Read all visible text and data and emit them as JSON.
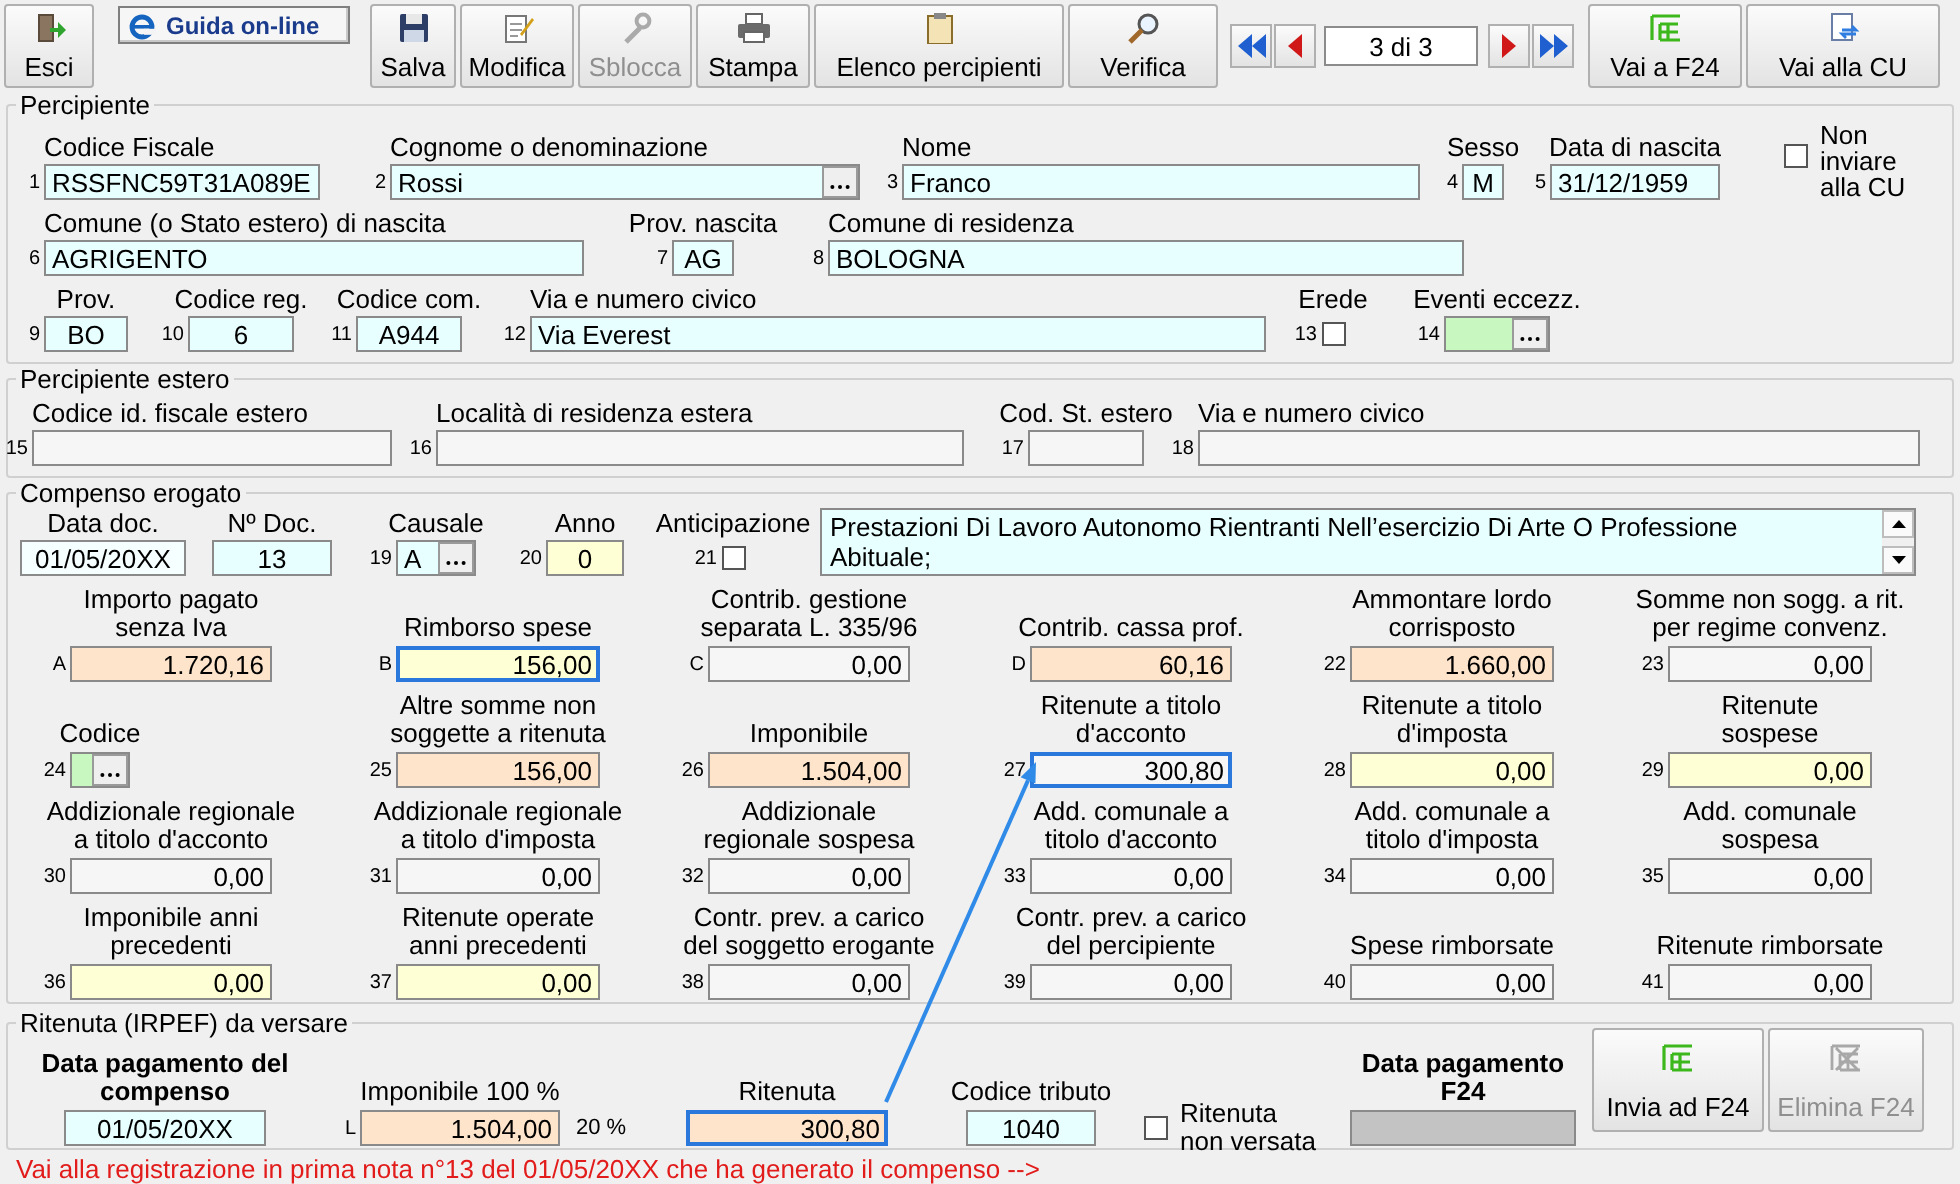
{
  "toolbar": {
    "exit_button": {
      "label": "Esci",
      "disabled": false
    },
    "help_link": "Guida on-line",
    "buttons": [
      {
        "label": "Salva",
        "disabled": false
      },
      {
        "label": "Modifica",
        "disabled": false
      },
      {
        "label": "Sblocca",
        "disabled": true
      },
      {
        "label": "Stampa",
        "disabled": false
      },
      {
        "label": "Elenco percipienti",
        "disabled": false
      },
      {
        "label": "Verifica",
        "disabled": false
      }
    ],
    "navigator": {
      "position": "3 di 3"
    },
    "right_buttons": [
      {
        "label": "Vai a F24",
        "disabled": false
      },
      {
        "label": "Vai alla CU",
        "disabled": false
      }
    ]
  },
  "percipiente": {
    "title": "Percipiente",
    "lines": [
      {
        "fields": [
          {
            "num": "1",
            "label": "Codice Fiscale",
            "value": "RSSFNC59T31A089E",
            "kind": "text",
            "color": "#e8ffff"
          },
          {
            "num": "2",
            "label": "Cognome o denominazione",
            "value": "Rossi",
            "kind": "lookup",
            "color": "#e8ffff"
          },
          {
            "num": "3",
            "label": "Nome",
            "value": "Franco",
            "kind": "text",
            "color": "#e8ffff"
          },
          {
            "num": "4",
            "label": "Sesso",
            "value": "M",
            "kind": "center",
            "color": "#e8ffff"
          },
          {
            "num": "5",
            "label": "Data di nascita",
            "value": "31/12/1959",
            "kind": "text",
            "color": "#e8ffff"
          }
        ]
      },
      {
        "fields": [
          {
            "num": "6",
            "label": "Comune (o Stato estero) di nascita",
            "value": "AGRIGENTO",
            "kind": "text",
            "color": "#e8ffff"
          },
          {
            "num": "7",
            "label": "Prov. nascita",
            "value": "AG",
            "kind": "center",
            "color": "#e8ffff"
          },
          {
            "num": "8",
            "label": "Comune di residenza",
            "value": "BOLOGNA",
            "kind": "text",
            "color": "#e8ffff"
          }
        ]
      },
      {
        "fields": [
          {
            "num": "9",
            "label": "Prov.",
            "value": "BO",
            "kind": "center",
            "color": "#e8ffff"
          },
          {
            "num": "10",
            "label": "Codice reg.",
            "value": "6",
            "kind": "center",
            "color": "#e8ffff"
          },
          {
            "num": "11",
            "label": "Codice com.",
            "value": "A944",
            "kind": "center",
            "color": "#e8ffff"
          },
          {
            "num": "12",
            "label": "Via e numero civico",
            "value": "Via Everest",
            "kind": "text",
            "color": "#e8ffff"
          },
          {
            "num": "13",
            "label": "Erede",
            "kind": "check",
            "checked": false
          },
          {
            "num": "14",
            "label": "Eventi eccezz.",
            "kind": "lookup",
            "color": "#c8f7c0"
          }
        ]
      }
    ],
    "non_inviare_cu": {
      "label": "Non inviare alla CU",
      "checked": false
    }
  },
  "percipiente_estero": {
    "title": "Percipiente estero",
    "lines": [
      {
        "fields": [
          {
            "num": "15",
            "label": "Codice id. fiscale estero",
            "color": "#f6f6f6"
          },
          {
            "num": "16",
            "label": "Località di residenza estera",
            "color": "#f6f6f6"
          },
          {
            "num": "17",
            "label": "Cod. St. estero",
            "color": "#f6f6f6"
          },
          {
            "num": "18",
            "label": "Via e numero civico",
            "color": "#f6f6f6"
          }
        ]
      }
    ]
  },
  "compenso": {
    "title": "Compenso erogato",
    "lines": [
      {
        "fields": [
          {
            "label": "Data doc.",
            "value": "01/05/20XX",
            "kind": "center",
            "color": "#f6ffff"
          },
          {
            "label": "Nº Doc.",
            "value": "13",
            "kind": "center",
            "color": "#e8ffff"
          },
          {
            "num": "19",
            "label": "Causale",
            "value": "A",
            "kind": "lookup",
            "color": "#e8ffff"
          },
          {
            "num": "20",
            "label": "Anno",
            "value": "0",
            "kind": "center",
            "color": "#ffffd5"
          },
          {
            "num": "21",
            "label": "Anticipazione",
            "kind": "check",
            "checked": false
          }
        ]
      },
      {
        "fields": [
          {
            "num": "A",
            "label": "Importo pagato\nsenza Iva",
            "value": "1.720,16",
            "kind": "amount",
            "color": "#fde4cb",
            "outlined": false
          },
          {
            "num": "B",
            "label": "Rimborso spese",
            "value": "156,00",
            "kind": "amount",
            "color": "#ffffd5",
            "outlined": true
          },
          {
            "num": "C",
            "label": "Contrib. gestione\nseparata L. 335/96",
            "value": "0,00",
            "kind": "amount",
            "color": "#f6f6f6",
            "outlined": false
          },
          {
            "num": "D",
            "label": "Contrib. cassa prof.",
            "value": "60,16",
            "kind": "amount",
            "color": "#fde4cb",
            "outlined": false
          },
          {
            "num": "22",
            "label": "Ammontare lordo\ncorrisposto",
            "value": "1.660,00",
            "kind": "amount",
            "color": "#fde4cb",
            "outlined": false
          },
          {
            "num": "23",
            "label": "Somme non sogg. a rit.\nper regime convenz.",
            "value": "0,00",
            "kind": "amount",
            "color": "#f6f6f6",
            "outlined": false
          }
        ]
      },
      {
        "fields": [
          {
            "num": "24",
            "label": "Codice",
            "kind": "lookup",
            "color": "#c8f7c0",
            "outlined": false
          },
          {
            "num": "25",
            "label": "Altre somme non\nsoggette a ritenuta",
            "value": "156,00",
            "kind": "amount",
            "color": "#fde4cb",
            "outlined": false
          },
          {
            "num": "26",
            "label": "Imponibile",
            "value": "1.504,00",
            "kind": "amount",
            "color": "#fde4cb",
            "outlined": false
          },
          {
            "num": "27",
            "label": "Ritenute a titolo\nd'acconto",
            "value": "300,80",
            "kind": "amount",
            "color": "#f6f6f6",
            "outlined": true
          },
          {
            "num": "28",
            "label": "Ritenute a titolo\nd'imposta",
            "value": "0,00",
            "kind": "amount",
            "color": "#ffffd5",
            "outlined": false
          },
          {
            "num": "29",
            "label": "Ritenute\nsospese",
            "value": "0,00",
            "kind": "amount",
            "color": "#ffffd5",
            "outlined": false
          }
        ]
      },
      {
        "fields": [
          {
            "num": "30",
            "label": "Addizionale regionale\na titolo d'acconto",
            "value": "0,00",
            "kind": "amount",
            "color": "#f6f6f6",
            "outlined": false
          },
          {
            "num": "31",
            "label": "Addizionale regionale\na titolo d'imposta",
            "value": "0,00",
            "kind": "amount",
            "color": "#f6f6f6",
            "outlined": false
          },
          {
            "num": "32",
            "label": "Addizionale\nregionale sospesa",
            "value": "0,00",
            "kind": "amount",
            "color": "#f6f6f6",
            "outlined": false
          },
          {
            "num": "33",
            "label": "Add. comunale a\ntitolo d'acconto",
            "value": "0,00",
            "kind": "amount",
            "color": "#f6f6f6",
            "outlined": false
          },
          {
            "num": "34",
            "label": "Add. comunale a\ntitolo d'imposta",
            "value": "0,00",
            "kind": "amount",
            "color": "#f6f6f6",
            "outlined": false
          },
          {
            "num": "35",
            "label": "Add. comunale\nsospesa",
            "value": "0,00",
            "kind": "amount",
            "color": "#f6f6f6",
            "outlined": false
          }
        ]
      },
      {
        "fields": [
          {
            "num": "36",
            "label": "Imponibile anni\nprecedenti",
            "value": "0,00",
            "kind": "amount",
            "color": "#ffffd5",
            "outlined": false
          },
          {
            "num": "37",
            "label": "Ritenute operate\nanni precedenti",
            "value": "0,00",
            "kind": "amount",
            "color": "#ffffd5",
            "outlined": false
          },
          {
            "num": "38",
            "label": "Contr. prev. a carico\ndel soggetto erogante",
            "value": "0,00",
            "kind": "amount",
            "color": "#f6f6f6",
            "outlined": false
          },
          {
            "num": "39",
            "label": "Contr. prev. a carico\ndel percipiente",
            "value": "0,00",
            "kind": "amount",
            "color": "#f6f6f6",
            "outlined": false
          },
          {
            "num": "40",
            "label": "Spese rimborsate",
            "value": "0,00",
            "kind": "amount",
            "color": "#f6f6f6",
            "outlined": false
          },
          {
            "num": "41",
            "label": "Ritenute rimborsate",
            "value": "0,00",
            "kind": "amount",
            "color": "#f6f6f6",
            "outlined": false
          }
        ]
      }
    ],
    "description": "Prestazioni Di Lavoro Autonomo Rientranti Nell’esercizio Di Arte O Professione Abituale;"
  },
  "ritenuta": {
    "title": "Ritenuta (IRPEF) da versare",
    "lines": [
      {
        "fields": [
          {
            "label": "Data pagamento del\ncompenso",
            "value": "01/05/20XX",
            "kind": "center",
            "color": "#e8ffff",
            "bold": true,
            "outlined": false
          },
          {
            "num": "L",
            "label": "Imponibile 100 %",
            "value": "1.504,00",
            "suffix": "20 %",
            "kind": "amount",
            "color": "#fde4cb",
            "bold": false,
            "outlined": false
          },
          {
            "label": "Ritenuta",
            "value": "300,80",
            "kind": "amount",
            "color": "#fde4cb",
            "bold": false,
            "outlined": true
          },
          {
            "label": "Codice tributo",
            "value": "1040",
            "kind": "center",
            "color": "#e8ffff",
            "bold": false,
            "outlined": false
          },
          {
            "label": "Ritenuta\nnon versata",
            "kind": "check_right",
            "checked": false,
            "bold": false
          },
          {
            "label": "Data pagamento\nF24",
            "color": "#c3c3c3",
            "bold": true,
            "outlined": false
          }
        ]
      }
    ],
    "buttons": [
      {
        "label": "Invia ad F24",
        "disabled": false
      },
      {
        "label": "Elimina F24",
        "disabled": true
      }
    ]
  },
  "registration_link": "Vai alla registrazione in prima nota n°13 del 01/05/20XX che ha generato il compenso -->"
}
